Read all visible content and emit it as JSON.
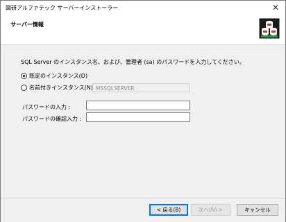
{
  "window": {
    "title": "図研アルファテック サーバーインストーラー",
    "close_symbol": "✕"
  },
  "header": {
    "title": "サーバー情報",
    "icon": "database-server-icon"
  },
  "body": {
    "instruction": "SQL Server のインスタンス名、および、管理者 (sa) のパスワードを入力してください。",
    "radio_default_label": "既定のインスタンス(D)",
    "radio_named_label": "名前付きインスタンス(N) :",
    "selected_radio": "default",
    "instance_name_value": "MSSQLSERVER",
    "password_label": "パスワードの入力 :",
    "password_value": "",
    "password_confirm_label": "パスワードの確認入力 :",
    "password_confirm_value": ""
  },
  "footer": {
    "back_label": "< 戻る(B)",
    "next_label": "次へ(N) >",
    "cancel_label": "キャンセル"
  },
  "colors": {
    "accent": "#0078d7",
    "icon_green": "#2a9d3a",
    "icon_red": "#c0392b"
  }
}
